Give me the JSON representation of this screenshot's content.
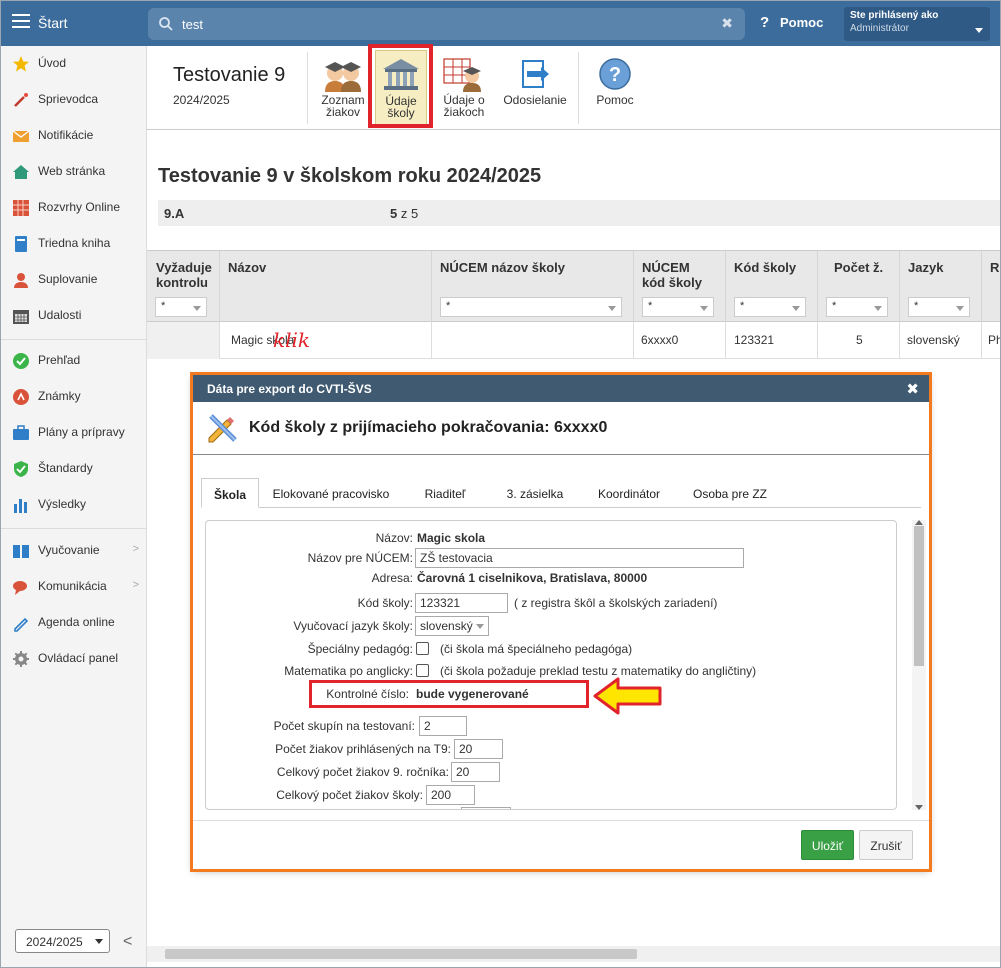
{
  "topbar": {
    "app_label": "Štart",
    "search_value": "test",
    "help_label": "Pomoc",
    "user_line1": "Ste prihlásený ako",
    "user_line2": "Administrátor"
  },
  "sidebar": {
    "items": [
      {
        "label": "Úvod",
        "icon": "star-icon"
      },
      {
        "label": "Sprievodca",
        "icon": "magic-wand-icon"
      },
      {
        "label": "Notifikácie",
        "icon": "envelope-icon"
      },
      {
        "label": "Web stránka",
        "icon": "home-icon"
      },
      {
        "label": "Rozvrhy Online",
        "icon": "schedule-grid-icon"
      },
      {
        "label": "Triedna kniha",
        "icon": "book-icon"
      },
      {
        "label": "Suplovanie",
        "icon": "person-icon"
      },
      {
        "label": "Udalosti",
        "icon": "calendar-icon"
      },
      {
        "label": "Prehľad",
        "icon": "check-circle-icon"
      },
      {
        "label": "Známky",
        "icon": "grade-icon"
      },
      {
        "label": "Plány a prípravy",
        "icon": "briefcase-icon"
      },
      {
        "label": "Štandardy",
        "icon": "shield-check-icon"
      },
      {
        "label": "Výsledky",
        "icon": "bar-chart-icon"
      },
      {
        "label": "Vyučovanie",
        "icon": "open-book-icon"
      },
      {
        "label": "Komunikácia",
        "icon": "chat-icon"
      },
      {
        "label": "Agenda online",
        "icon": "pen-icon"
      },
      {
        "label": "Ovládací panel",
        "icon": "gear-icon"
      }
    ],
    "year": "2024/2025"
  },
  "toolbar": {
    "title": "Testovanie 9",
    "subtitle": "2024/2025",
    "buttons": [
      {
        "label": "Zoznam žiakov",
        "icon": "students-icon"
      },
      {
        "label": "Údaje školy",
        "icon": "school-building-icon"
      },
      {
        "label": "Údaje o žiakoch",
        "icon": "student-table-icon"
      },
      {
        "label": "Odosielanie",
        "icon": "send-arrow-icon"
      },
      {
        "label": "Pomoc",
        "icon": "help-icon"
      }
    ]
  },
  "page": {
    "heading": "Testovanie 9 v školskom roku 2024/2025",
    "class_name": "9.A",
    "progress_num": "5",
    "progress_rest": "z 5"
  },
  "grid": {
    "columns": [
      "Vyžaduje kontrolu",
      "Názov",
      "NÚCEM názov školy",
      "NÚCEM kód školy",
      "Kód školy",
      "Počet ž.",
      "Jazyk",
      "R"
    ],
    "filter_value": "*",
    "row": {
      "nazov": "Magic skola",
      "nucem_nazov": "",
      "nucem_kod": "6xxxx0",
      "kod": "123321",
      "pocet": "5",
      "jazyk": "slovenský",
      "r": "Ph"
    },
    "annotation": "klik"
  },
  "modal": {
    "title": "Dáta pre export do CVTI-ŠVS",
    "heading": "Kód školy z prijímacieho pokračovania: 6xxxx0",
    "tabs": [
      "Škola",
      "Elokované pracovisko",
      "Riaditeľ",
      "3. zásielka",
      "Koordinátor",
      "Osoba pre ZZ"
    ],
    "fields": {
      "nazov_label": "Názov:",
      "nazov_value": "Magic skola",
      "nazov_nucem_label": "Názov pre NÚCEM:",
      "nazov_nucem_value": "ZŠ testovacia",
      "adresa_label": "Adresa:",
      "adresa_value": "Čarovná 1 ciselnikova, Bratislava, 80000",
      "kod_label": "Kód školy:",
      "kod_value": "123321",
      "kod_hint": "( z registra škôl a školských zariadení)",
      "jazyk_label": "Vyučovací jazyk školy:",
      "jazyk_value": "slovenský",
      "spec_label": "Špeciálny pedagóg:",
      "spec_hint": "(či škola má špeciálneho pedagóga)",
      "mat_label": "Matematika po anglicky:",
      "mat_hint": "(či škola požaduje preklad testu z matematiky do angličtiny)",
      "kontrol_label": "Kontrolné číslo:",
      "kontrol_value": "bude vygenerované",
      "skupiny_label": "Počet skupín na testovaní:",
      "skupiny_value": "2",
      "prihl_label": "Počet žiakov prihlásených na T9:",
      "prihl_value": "20",
      "rocnik_label": "Celkový počet žiakov 9. ročníka:",
      "rocnik_value": "20",
      "skola_label": "Celkový počet žiakov školy:",
      "skola_value": "200"
    },
    "save_label": "Uložiť",
    "cancel_label": "Zrušiť"
  },
  "colors": {
    "topbar": "#3c6c9c",
    "modal_title": "#3f5a71",
    "highlight_red": "#e1242b",
    "modal_border": "#f47a20",
    "save_green": "#3aa046",
    "arrow_yellow": "#ffe600"
  }
}
